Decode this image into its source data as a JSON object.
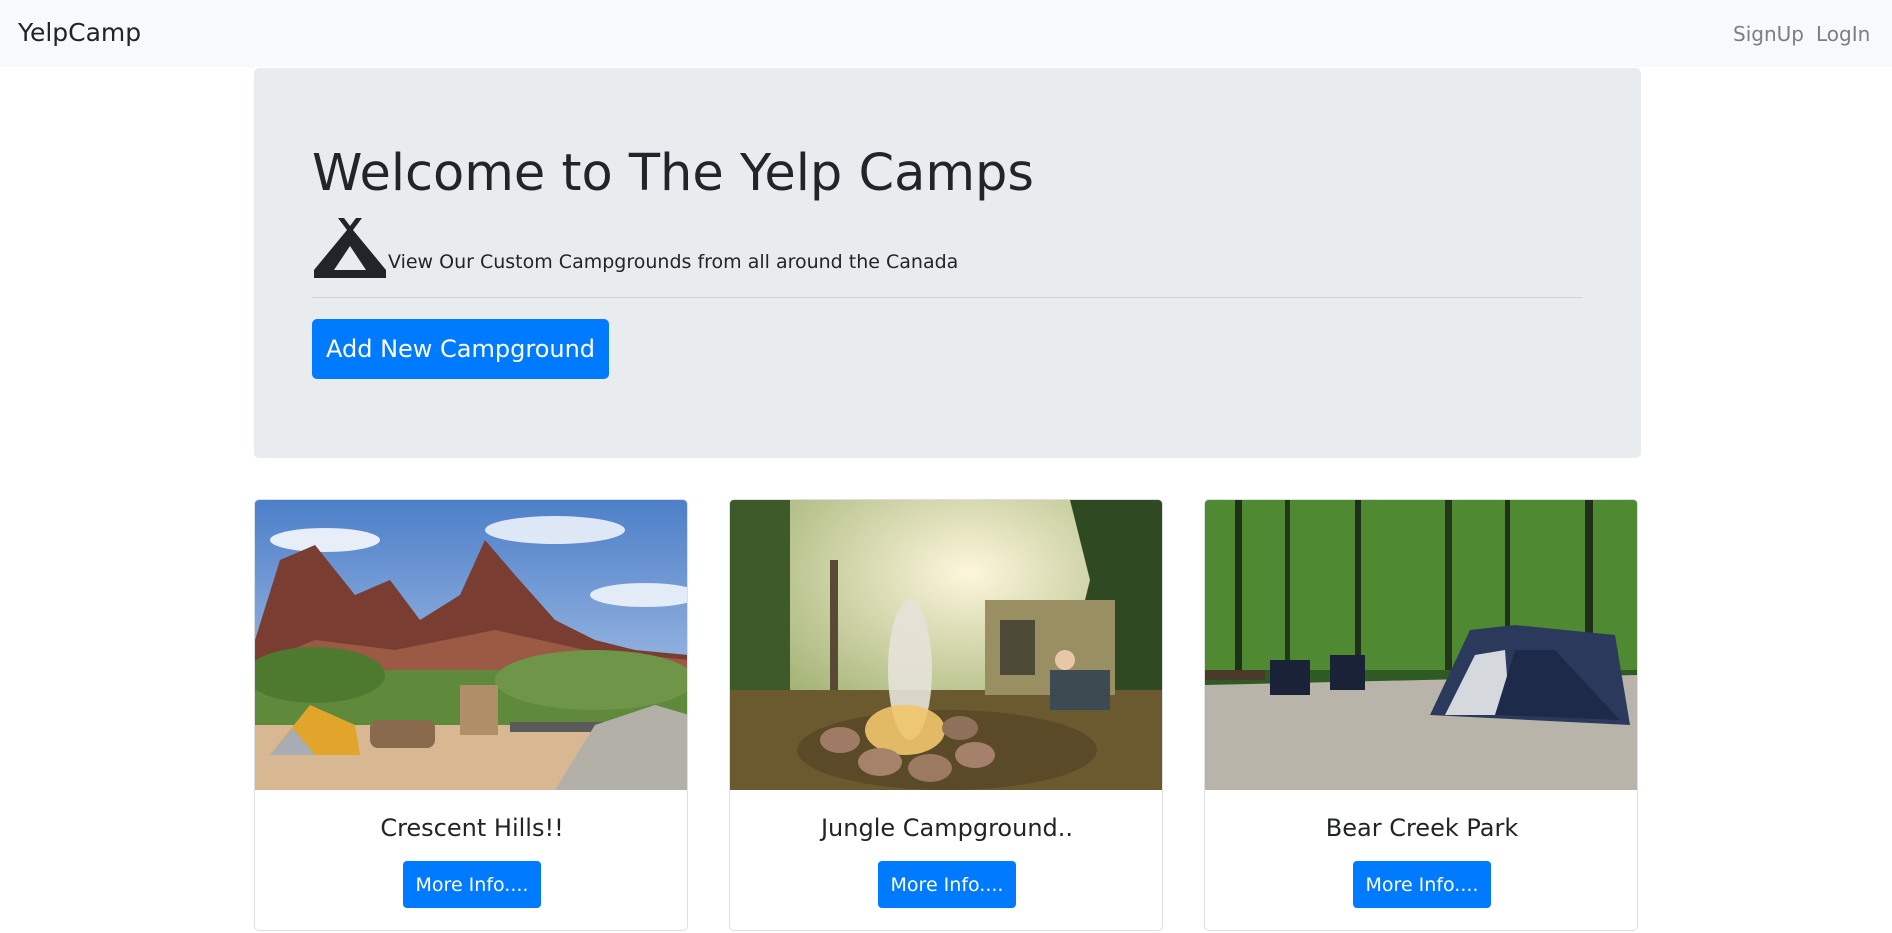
{
  "navbar": {
    "brand": "YelpCamp",
    "links": [
      {
        "label": "SignUp"
      },
      {
        "label": "LogIn"
      }
    ]
  },
  "jumbotron": {
    "title": "Welcome to The Yelp Camps",
    "icon": "campground-tent-icon",
    "lead": "View Our Custom Campgrounds from all around the Canada",
    "button_label": "Add New Campground"
  },
  "campgrounds": [
    {
      "name": "Crescent Hills!!",
      "button_label": "More Info....",
      "image": "mountain-campsite-photo"
    },
    {
      "name": "Jungle Campground..",
      "button_label": "More Info....",
      "image": "campfire-campsite-photo"
    },
    {
      "name": "Bear Creek Park",
      "button_label": "More Info....",
      "image": "forest-tent-campsite-photo"
    }
  ],
  "colors": {
    "primary": "#007bff",
    "navbar_bg": "#f8f9fa",
    "jumbotron_bg": "#e9ecef",
    "text": "#212529",
    "nav_link": "#7a7f85"
  }
}
